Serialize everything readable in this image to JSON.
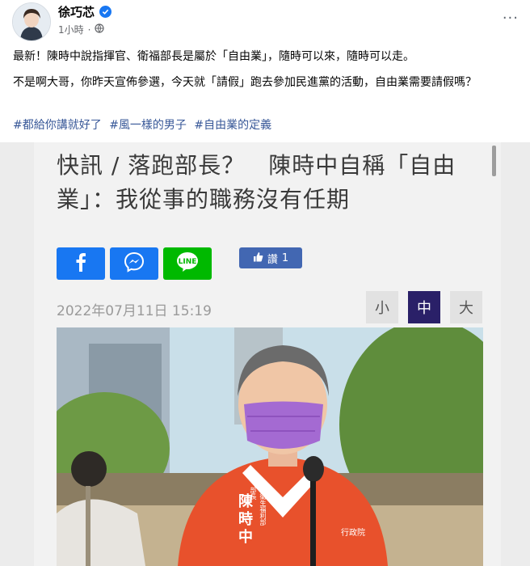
{
  "post": {
    "author": "徐巧芯",
    "time": "1小時",
    "dot": "·",
    "more": "···",
    "text_line1": "最新！陳時中說指揮官、衛福部長是屬於「自由業」，隨時可以來，隨時可以走。",
    "text_line2": "不是啊大哥，你昨天宣佈參選，今天就「請假」跑去參加民進黨的活動，自由業需要請假嗎？",
    "hashtags": [
      "#都給你講就好了",
      "#風一樣的男子",
      "#自由業的定義"
    ]
  },
  "article": {
    "headline": "快訊 / 落跑部長？　陳時中自稱「自由業」：我從事的職務沒有任期",
    "like_label": "讚",
    "like_count": "1",
    "date": "2022年07月11日 15:19",
    "font_size_options": [
      {
        "label": "小",
        "selected": false
      },
      {
        "label": "中",
        "selected": true
      },
      {
        "label": "大",
        "selected": false
      }
    ],
    "share_buttons": [
      {
        "icon": "facebook-icon",
        "color": "#1877f2"
      },
      {
        "icon": "messenger-icon",
        "color": "#1877f2"
      },
      {
        "icon": "line-icon",
        "color": "#00b900"
      }
    ],
    "photo_vest_text": [
      "陳",
      "時",
      "中"
    ],
    "photo_vest_small_left": "衛生福利部",
    "photo_vest_small_left2": "部長",
    "photo_vest_small_right": "行政院"
  },
  "colors": {
    "link": "#385898",
    "verified": "#1877f2",
    "selected_size_bg": "#2a2068",
    "unselected_size_bg": "#e2e2e2",
    "vest": "#e8512c",
    "mask": "#a46ad2"
  }
}
